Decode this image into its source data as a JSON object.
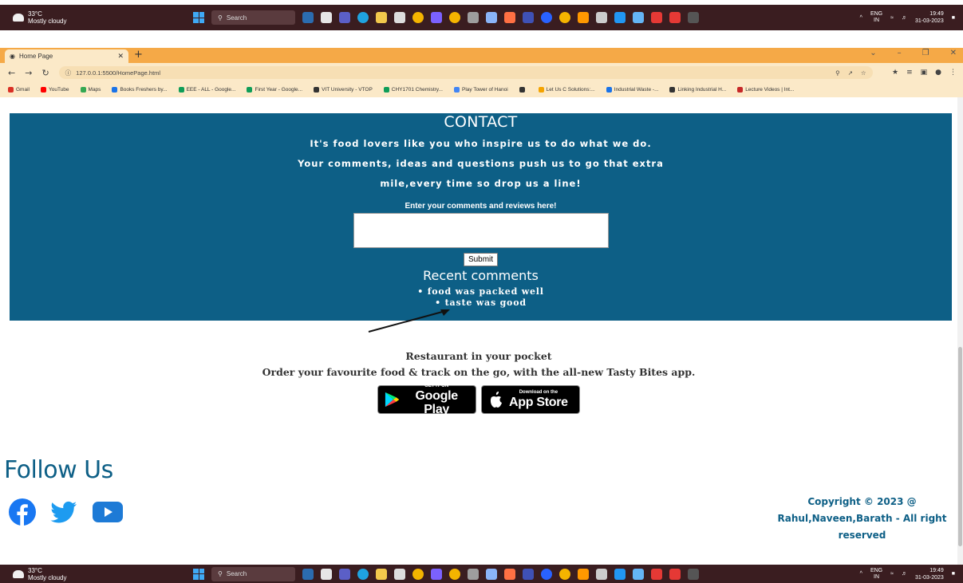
{
  "taskbar": {
    "temp": "33°C",
    "weather": "Mostly cloudy",
    "search_placeholder": "Search",
    "lang": "ENG",
    "region": "IN",
    "time": "19:49",
    "date": "31-03-2023"
  },
  "browser": {
    "tab_title": "Home Page",
    "url": "127.0.0.1:5500/HomePage.html",
    "bookmarks": [
      {
        "label": "Gmail",
        "color": "#d93025"
      },
      {
        "label": "YouTube",
        "color": "#ff0000"
      },
      {
        "label": "Maps",
        "color": "#34a853"
      },
      {
        "label": "Books Freshers by...",
        "color": "#1a73e8"
      },
      {
        "label": "EEE - ALL - Google...",
        "color": "#0f9d58"
      },
      {
        "label": "First Year - Google...",
        "color": "#0f9d58"
      },
      {
        "label": "VIT University - VTOP",
        "color": "#333333"
      },
      {
        "label": "CHY1701 Chemistry...",
        "color": "#0f9d58"
      },
      {
        "label": "Play Tower of Hanoi",
        "color": "#4285f4"
      },
      {
        "label": "",
        "color": "#333333"
      },
      {
        "label": "Let Us C Solutions:...",
        "color": "#f4a300"
      },
      {
        "label": "Industrial Waste -...",
        "color": "#1a73e8"
      },
      {
        "label": "Linking Industrial H...",
        "color": "#333333"
      },
      {
        "label": "Lecture Videos | Int...",
        "color": "#c62828"
      }
    ]
  },
  "contact": {
    "heading": "CONTACT",
    "line1": "It's food lovers like you who inspire us to do what we do.",
    "line2": "Your comments, ideas and questions push us to go that extra",
    "line3": "mile,every time so drop us a line!",
    "prompt": "Enter your comments and reviews here!",
    "submit_label": "Submit",
    "recent_heading": "Recent comments",
    "comments": [
      "food was packed well",
      "taste was good"
    ]
  },
  "promo": {
    "title": "Restaurant in your pocket",
    "subtitle": "Order your favourite food & track on the go, with the all-new Tasty Bites app.",
    "google_small": "GET IT ON",
    "google_big": "Google Play",
    "apple_small": "Download on the",
    "apple_big": "App Store"
  },
  "footer": {
    "follow": "Follow Us",
    "copyright_l1": "Copyright © 2023 @",
    "copyright_l2": "Rahul,Naveen,Barath - All right",
    "copyright_l3": "reserved"
  },
  "colors": {
    "brand": "#0d5f86",
    "tab_strip": "#f5a947",
    "taskbar": "#3a1d20"
  },
  "icons": [
    "facebook-icon",
    "twitter-icon",
    "youtube-icon",
    "google-play-icon",
    "apple-icon"
  ]
}
